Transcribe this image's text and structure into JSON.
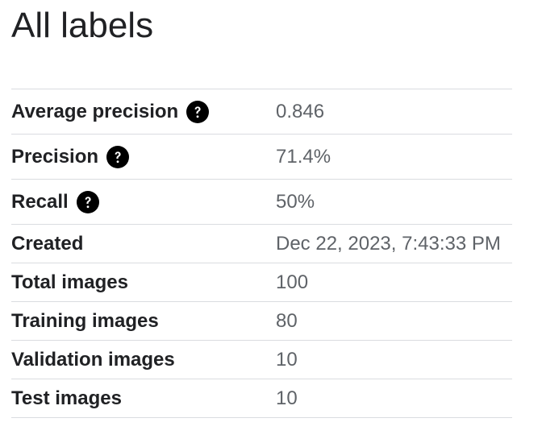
{
  "page": {
    "title": "All labels"
  },
  "metrics": [
    {
      "label": "Average precision",
      "value": "0.846",
      "help_icon": "help-circle-icon"
    },
    {
      "label": "Precision",
      "value": "71.4%",
      "help_icon": "help-circle-icon"
    },
    {
      "label": "Recall",
      "value": "50%",
      "help_icon": "help-circle-icon"
    },
    {
      "label": "Created",
      "value": "Dec 22, 2023, 7:43:33 PM"
    },
    {
      "label": "Total images",
      "value": "100"
    },
    {
      "label": "Training images",
      "value": "80"
    },
    {
      "label": "Validation images",
      "value": "10"
    },
    {
      "label": "Test images",
      "value": "10"
    }
  ],
  "colors": {
    "text_primary": "#202124",
    "text_secondary": "#5f6368",
    "divider": "#dadce0",
    "icon": "#000000"
  }
}
